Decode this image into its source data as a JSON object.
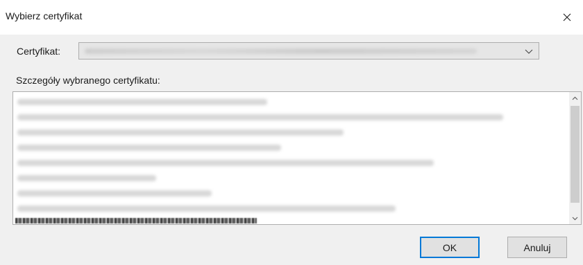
{
  "dialog": {
    "title": "Wybierz certyfikat",
    "certificate_label": "Certyfikat:",
    "certificate_value": "",
    "details_label": "Szczegóły wybranego certyfikatu:",
    "details_lines": [],
    "ok_label": "OK",
    "cancel_label": "Anuluj",
    "accent_color": "#0078d7"
  }
}
